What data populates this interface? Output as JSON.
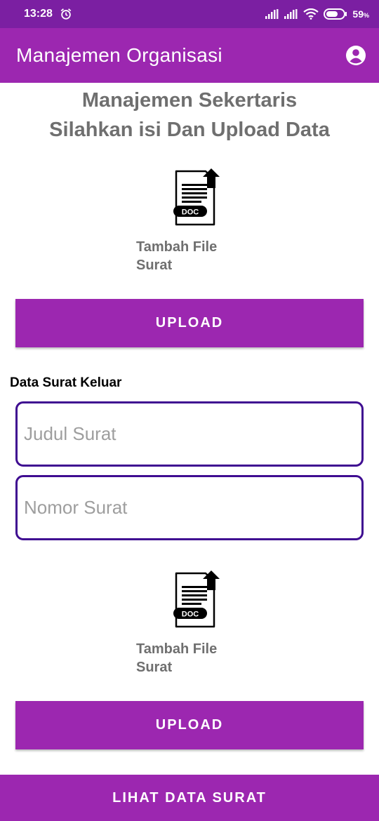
{
  "status_bar": {
    "time": "13:28",
    "battery": "59",
    "battery_unit": "%"
  },
  "app_bar": {
    "title": "Manajemen Organisasi",
    "account_icon": "account-circle-icon"
  },
  "heading": {
    "line1": "Manajemen Sekertaris",
    "line2": "Silahkan isi Dan Upload Data"
  },
  "upload_section_1": {
    "icon": "doc-upload-icon",
    "doc_tag": "DOC",
    "label_line1": "Tambah File",
    "label_line2": "Surat",
    "button_label": "UPLOAD"
  },
  "surat_keluar": {
    "section_label": "Data Surat Keluar",
    "judul_placeholder": "Judul Surat",
    "judul_value": "",
    "nomor_placeholder": "Nomor Surat",
    "nomor_value": ""
  },
  "upload_section_2": {
    "icon": "doc-upload-icon",
    "doc_tag": "DOC",
    "label_line1": "Tambah File",
    "label_line2": "Surat",
    "button_label": "UPLOAD"
  },
  "bottom": {
    "button_label": "LIHAT DATA SURAT"
  },
  "colors": {
    "status_bar": "#7b1fa2",
    "primary": "#9c27b0",
    "field_border": "#3f0d91",
    "heading_text": "#6f6f6f"
  }
}
